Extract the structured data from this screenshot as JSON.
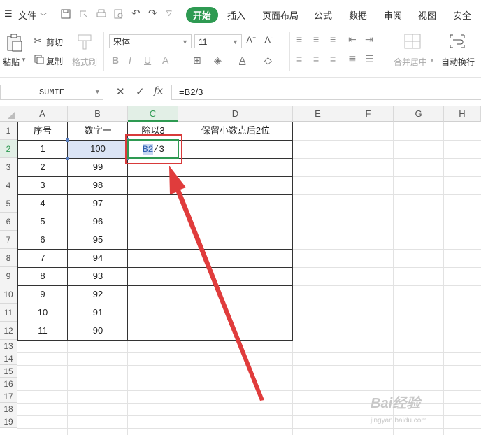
{
  "menubar": {
    "menu_label": "文件",
    "tabs": [
      "开始",
      "插入",
      "页面布局",
      "公式",
      "数据",
      "审阅",
      "视图",
      "安全"
    ],
    "active_tab": "开始"
  },
  "ribbon": {
    "paste": "粘贴",
    "cut": "剪切",
    "copy": "复制",
    "format_painter": "格式刷",
    "font_name": "宋体",
    "font_size": "11",
    "merge_center": "合并居中",
    "wrap_text": "自动换行"
  },
  "formula_bar": {
    "name_box": "SUMIF",
    "cancel_symbol": "✕",
    "confirm_symbol": "✓",
    "fx_label": "fx",
    "formula": "=B2/3"
  },
  "columns": [
    "A",
    "B",
    "C",
    "D",
    "E",
    "F",
    "G",
    "H"
  ],
  "rows": [
    "1",
    "2",
    "3",
    "4",
    "5",
    "6",
    "7",
    "8",
    "9",
    "10",
    "11",
    "12",
    "13",
    "14",
    "15",
    "16",
    "17",
    "18",
    "19"
  ],
  "table": {
    "headers": [
      "序号",
      "数字一",
      "除以3",
      "保留小数点后2位"
    ],
    "serial": [
      "1",
      "2",
      "3",
      "4",
      "5",
      "6",
      "7",
      "8",
      "9",
      "10",
      "11"
    ],
    "numbers": [
      "100",
      "99",
      "98",
      "97",
      "96",
      "95",
      "94",
      "93",
      "92",
      "91",
      "90"
    ]
  },
  "editing_cell": {
    "prefix": "=",
    "ref": "B2",
    "suffix": "/3"
  },
  "watermark": {
    "brand": "Bai经验",
    "url": "jingyan.baidu.com"
  },
  "colors": {
    "accent_green": "#2e9a52",
    "annotation_red": "#d83a3a",
    "ref_highlight": "#dbe4f5"
  }
}
